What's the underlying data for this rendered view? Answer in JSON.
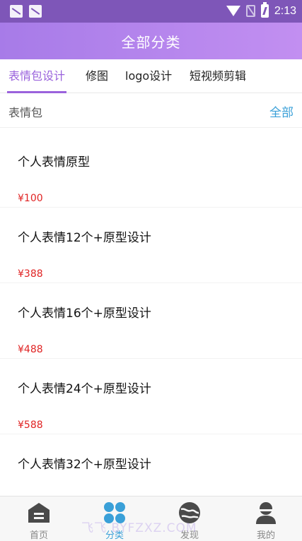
{
  "status_bar": {
    "time": "2:13"
  },
  "header": {
    "title": "全部分类"
  },
  "tabs": [
    {
      "label": "表情包设计",
      "active": true
    },
    {
      "label": "修图",
      "active": false
    },
    {
      "label": "logo设计",
      "active": false
    },
    {
      "label": "短视频剪辑",
      "active": false
    }
  ],
  "section": {
    "label": "表情包",
    "all_link": "全部"
  },
  "items": [
    {
      "title": "个人表情原型",
      "price": "¥100"
    },
    {
      "title": "个人表情12个+原型设计",
      "price": "¥388"
    },
    {
      "title": "个人表情16个+原型设计",
      "price": "¥488"
    },
    {
      "title": "个人表情24个+原型设计",
      "price": "¥588"
    },
    {
      "title": "个人表情32个+原型设计",
      "price": ""
    }
  ],
  "bottom_nav": [
    {
      "label": "首页",
      "icon": "home-icon",
      "active": false
    },
    {
      "label": "分类",
      "icon": "grid-icon",
      "active": true
    },
    {
      "label": "发现",
      "icon": "globe-icon",
      "active": false
    },
    {
      "label": "我的",
      "icon": "user-icon",
      "active": false
    }
  ],
  "watermark": "飞飞 BYFZXZ.COM",
  "colors": {
    "accent": "#9a62dc",
    "status_bar": "#7e56b8",
    "link": "#3aa0d8",
    "price": "#e02323"
  }
}
